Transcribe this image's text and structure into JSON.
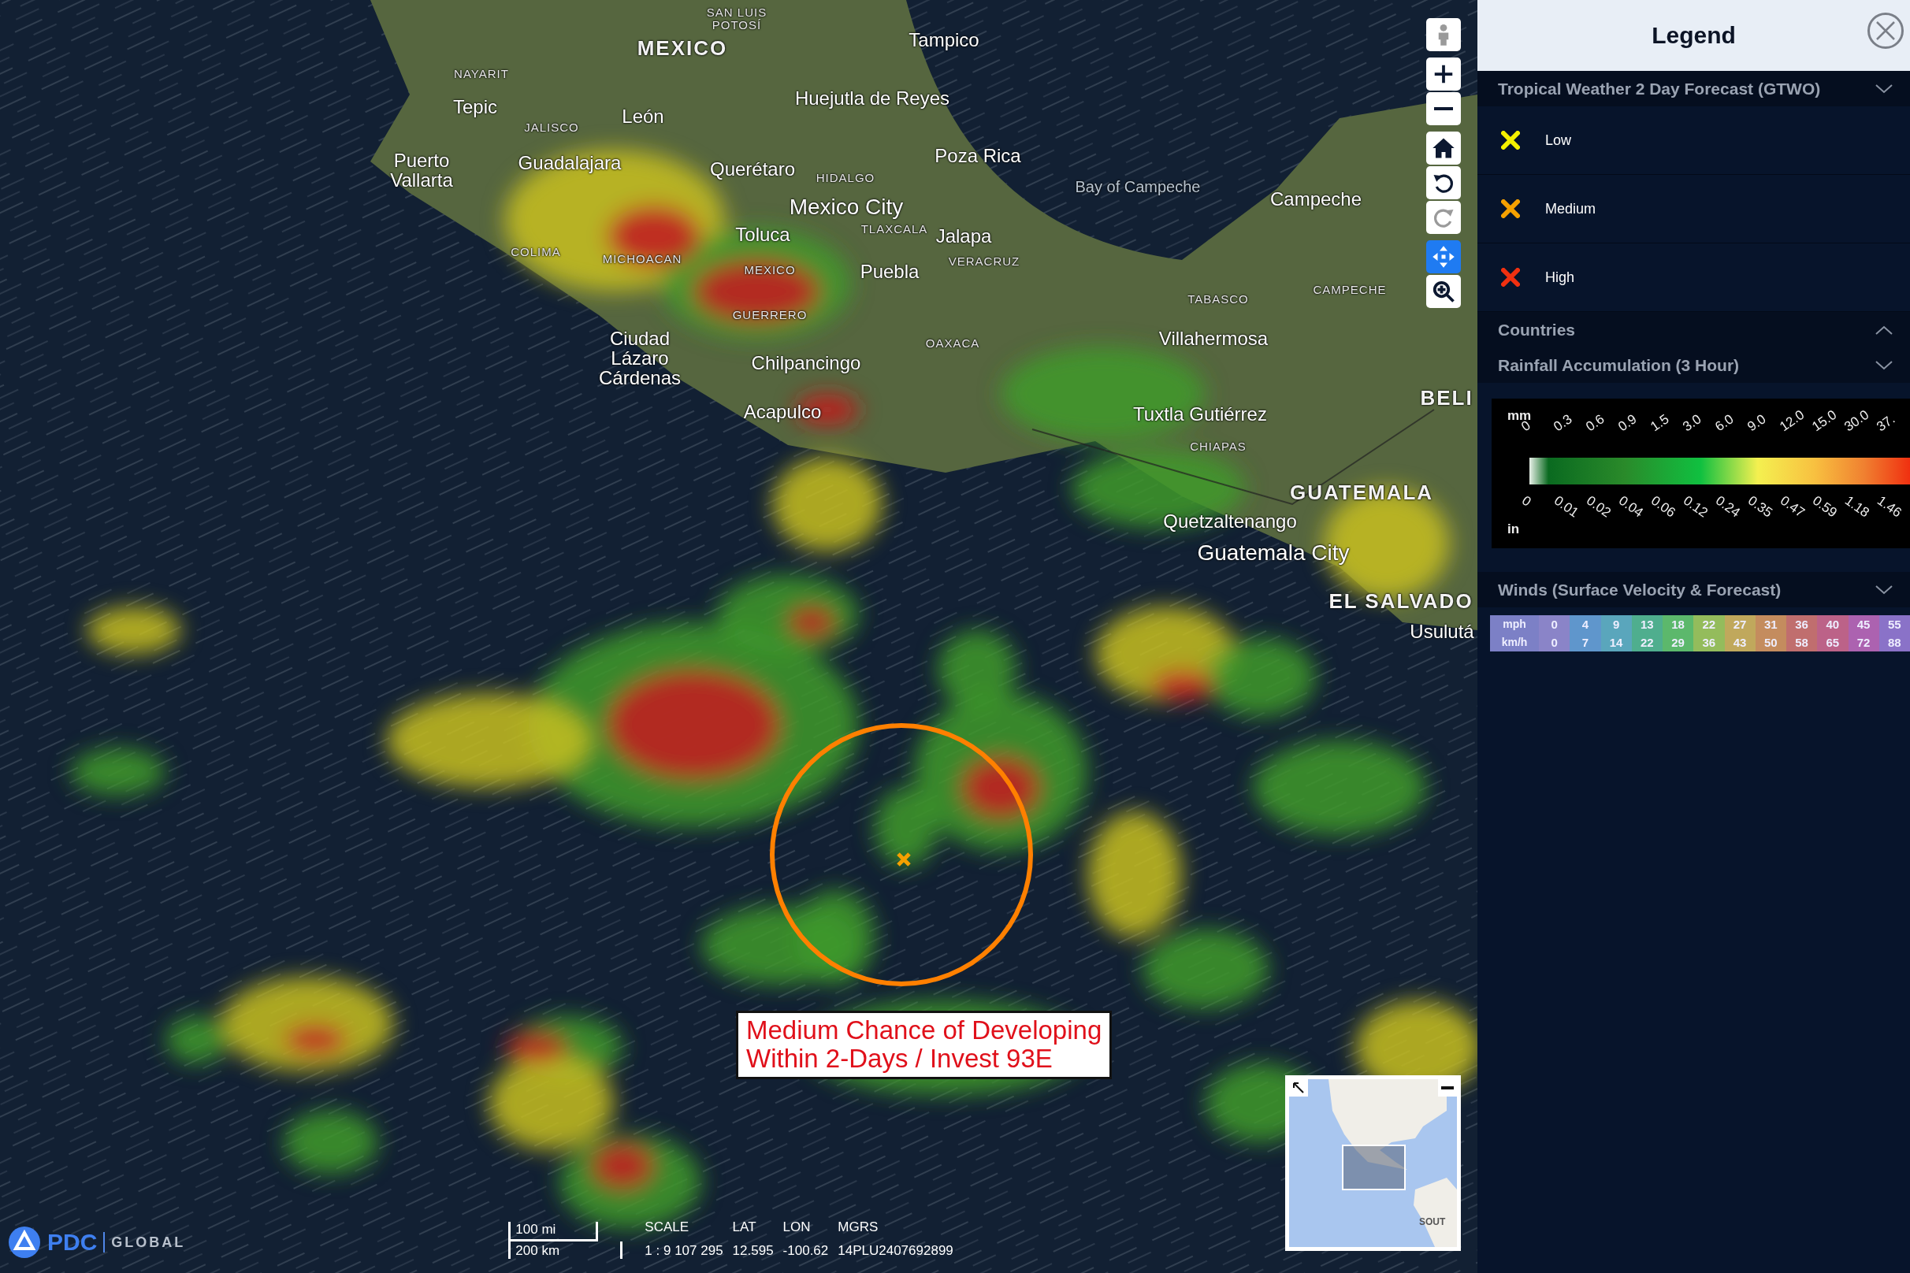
{
  "map": {
    "labels": [
      {
        "text": "SAN LUIS POTOSÍ",
        "kind": "region"
      },
      {
        "text": "MEXICO",
        "kind": "country"
      },
      {
        "text": "Tampico",
        "kind": "city"
      },
      {
        "text": "NAYARIT",
        "kind": "region"
      },
      {
        "text": "Tepic",
        "kind": "city"
      },
      {
        "text": "JALISCO",
        "kind": "region"
      },
      {
        "text": "León",
        "kind": "city"
      },
      {
        "text": "Huejutla de Reyes",
        "kind": "city"
      },
      {
        "text": "Puerto Vallarta",
        "kind": "city"
      },
      {
        "text": "Guadalajara",
        "kind": "city"
      },
      {
        "text": "Querétaro",
        "kind": "city"
      },
      {
        "text": "HIDALGO",
        "kind": "region"
      },
      {
        "text": "Poza Rica",
        "kind": "city"
      },
      {
        "text": "Bay of Campeche",
        "kind": "water"
      },
      {
        "text": "Campeche",
        "kind": "city"
      },
      {
        "text": "Mexico City",
        "kind": "capital"
      },
      {
        "text": "Toluca",
        "kind": "city"
      },
      {
        "text": "TLAXCALA",
        "kind": "region"
      },
      {
        "text": "Jalapa",
        "kind": "city"
      },
      {
        "text": "COLIMA",
        "kind": "region"
      },
      {
        "text": "MICHOACAN",
        "kind": "region"
      },
      {
        "text": "MEXICO",
        "kind": "region"
      },
      {
        "text": "VERACRUZ",
        "kind": "region"
      },
      {
        "text": "Puebla",
        "kind": "city"
      },
      {
        "text": "GUERRERO",
        "kind": "region"
      },
      {
        "text": "TABASCO",
        "kind": "region"
      },
      {
        "text": "CAMPECHE",
        "kind": "region"
      },
      {
        "text": "Ciudad Lázaro Cárdenas",
        "kind": "city"
      },
      {
        "text": "OAXACA",
        "kind": "region"
      },
      {
        "text": "Villahermosa",
        "kind": "city"
      },
      {
        "text": "Chilpancingo",
        "kind": "city"
      },
      {
        "text": "Acapulco",
        "kind": "city"
      },
      {
        "text": "Tuxtla Gutiérrez",
        "kind": "city"
      },
      {
        "text": "CHIAPAS",
        "kind": "region"
      },
      {
        "text": "BELI",
        "kind": "country"
      },
      {
        "text": "GUATEMALA",
        "kind": "country"
      },
      {
        "text": "Quetzaltenango",
        "kind": "city"
      },
      {
        "text": "Guatemala City",
        "kind": "capital"
      },
      {
        "text": "EL SALVADO",
        "kind": "country"
      },
      {
        "text": "Usulutá",
        "kind": "city"
      }
    ],
    "callout": {
      "lines": [
        "Medium Chance of Developing",
        "Within 2-Days / Invest 93E"
      ],
      "color": "#ff8000"
    },
    "controls": [
      {
        "kind": "streetview",
        "disabled": true,
        "selected": false
      },
      {
        "kind": "zoom-in",
        "disabled": false,
        "selected": false
      },
      {
        "kind": "zoom-out",
        "disabled": false,
        "selected": false
      },
      {
        "kind": "home",
        "disabled": false,
        "selected": false
      },
      {
        "kind": "undo",
        "disabled": false,
        "selected": false
      },
      {
        "kind": "redo",
        "disabled": true,
        "selected": false
      },
      {
        "kind": "pan",
        "disabled": false,
        "selected": true
      },
      {
        "kind": "zoom-box",
        "disabled": false,
        "selected": false
      }
    ],
    "overview": {
      "label": "SOUT"
    },
    "logo": {
      "brand": "PDC",
      "suffix": "GLOBAL"
    },
    "scale_bar": {
      "top": "100 mi",
      "bottom": "200 km"
    },
    "readouts": [
      {
        "label": "SCALE",
        "value": "1 : 9 107 295"
      },
      {
        "label": "LAT",
        "value": "12.595"
      },
      {
        "label": "LON",
        "value": "-100.62"
      },
      {
        "label": "MGRS",
        "value": "14PLU2407692899"
      }
    ]
  },
  "legend": {
    "title": "Legend",
    "sections": [
      {
        "kind": "markers",
        "title": "Tropical Weather 2 Day Forecast (GTWO)",
        "expanded": true,
        "items": [
          {
            "label": "Low",
            "color": "#f5f000"
          },
          {
            "label": "Medium",
            "color": "#f5a000"
          },
          {
            "label": "High",
            "color": "#f03010"
          }
        ]
      },
      {
        "title": "Countries",
        "expanded": false
      },
      {
        "kind": "rainfall",
        "title": "Rainfall Accumulation (3 Hour)",
        "expanded": true,
        "top_unit": "mm",
        "bottom_unit": "in",
        "top_values": [
          "0",
          "0.3",
          "0.6",
          "0.9",
          "1.5",
          "3.0",
          "6.0",
          "9.0",
          "12.0",
          "15.0",
          "30.0",
          "37."
        ],
        "bottom_values": [
          "0",
          "0.01",
          "0.02",
          "0.04",
          "0.06",
          "0.12",
          "0.24",
          "0.35",
          "0.47",
          "0.59",
          "1.18",
          "1.46"
        ]
      },
      {
        "kind": "winds",
        "title": "Winds (Surface Velocity & Forecast)",
        "expanded": true,
        "row_labels": [
          "mph",
          "km/h"
        ],
        "columns": [
          {
            "mph": "0",
            "kmh": "0",
            "color": "#8a84c8"
          },
          {
            "mph": "4",
            "kmh": "7",
            "color": "#5f96cc"
          },
          {
            "mph": "9",
            "kmh": "14",
            "color": "#5aa6bc"
          },
          {
            "mph": "13",
            "kmh": "22",
            "color": "#4fae8e"
          },
          {
            "mph": "18",
            "kmh": "29",
            "color": "#5cb86c"
          },
          {
            "mph": "22",
            "kmh": "36",
            "color": "#94bc5c"
          },
          {
            "mph": "27",
            "kmh": "43",
            "color": "#c0a85c"
          },
          {
            "mph": "31",
            "kmh": "50",
            "color": "#c48c5e"
          },
          {
            "mph": "36",
            "kmh": "58",
            "color": "#c06e6e"
          },
          {
            "mph": "40",
            "kmh": "65",
            "color": "#bc6288"
          },
          {
            "mph": "45",
            "kmh": "72",
            "color": "#ac62b0"
          },
          {
            "mph": "55",
            "kmh": "88",
            "color": "#8a72c8"
          }
        ]
      }
    ]
  }
}
